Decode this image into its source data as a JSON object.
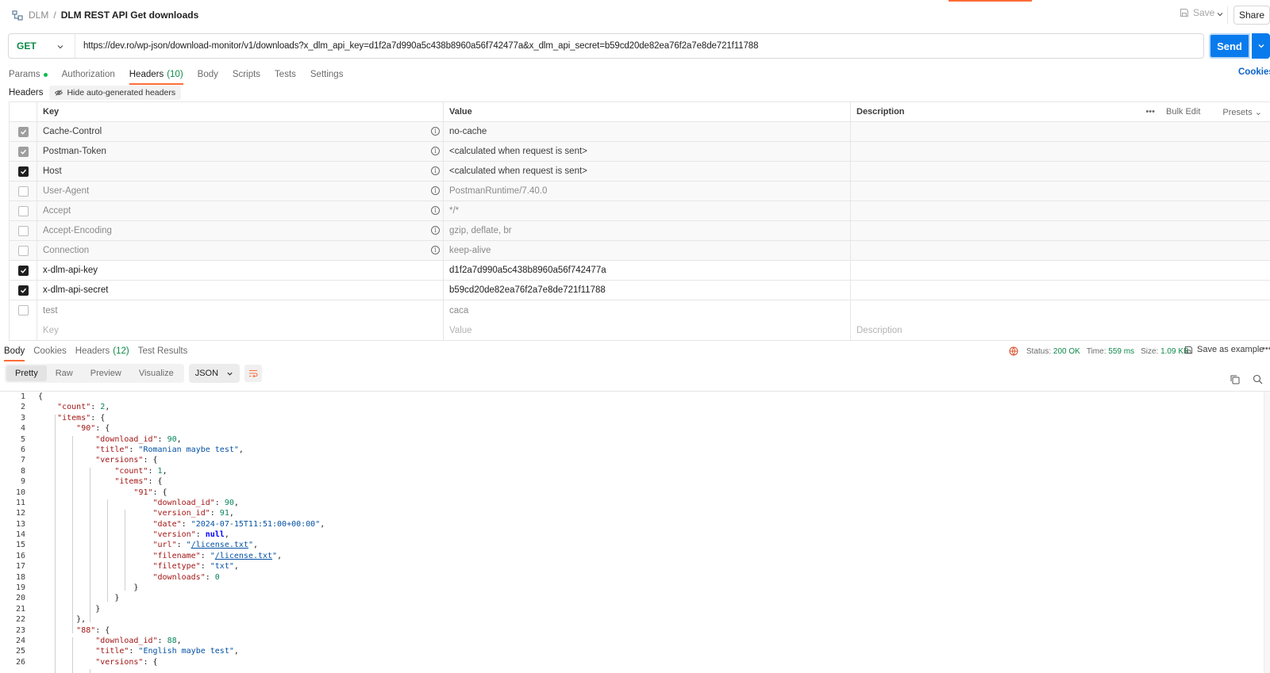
{
  "breadcrumb": {
    "collection": "DLM",
    "separator": "/",
    "request": "DLM REST API Get downloads"
  },
  "top_actions": {
    "save": "Save",
    "share": "Share"
  },
  "request": {
    "method": "GET",
    "url": "https://dev.ro/wp-json/download-monitor/v1/downloads?x_dlm_api_key=d1f2a7d990a5c438b8960a56f742477a&x_dlm_api_secret=b59cd20de82ea76f2a7e8de721f11788",
    "send": "Send"
  },
  "request_tabs": [
    {
      "label": "Params",
      "dot": true
    },
    {
      "label": "Authorization"
    },
    {
      "label": "Headers",
      "count": "(10)",
      "active": true
    },
    {
      "label": "Body"
    },
    {
      "label": "Scripts"
    },
    {
      "label": "Tests"
    },
    {
      "label": "Settings"
    }
  ],
  "cookies_link": "Cookies",
  "headers_section": {
    "label": "Headers",
    "hide_button": "Hide auto-generated headers"
  },
  "headers_table": {
    "columns": {
      "key": "Key",
      "value": "Value",
      "description": "Description"
    },
    "actions": {
      "bulk_edit": "Bulk Edit",
      "presets": "Presets"
    },
    "rows": [
      {
        "key": "Cache-Control",
        "value": "no-cache",
        "checked": "auto",
        "info": true,
        "style": "auto"
      },
      {
        "key": "Postman-Token",
        "value": "<calculated when request is sent>",
        "checked": "auto",
        "info": true,
        "style": "auto"
      },
      {
        "key": "Host",
        "value": "<calculated when request is sent>",
        "checked": "on",
        "info": true,
        "style": "auto"
      },
      {
        "key": "User-Agent",
        "value": "PostmanRuntime/7.40.0",
        "checked": "off",
        "info": true,
        "style": "autooff"
      },
      {
        "key": "Accept",
        "value": "*/*",
        "checked": "off",
        "info": true,
        "style": "autooff"
      },
      {
        "key": "Accept-Encoding",
        "value": "gzip, deflate, br",
        "checked": "off",
        "info": true,
        "style": "autooff"
      },
      {
        "key": "Connection",
        "value": "keep-alive",
        "checked": "off",
        "info": true,
        "style": "autooff"
      },
      {
        "key": "x-dlm-api-key",
        "value": "d1f2a7d990a5c438b8960a56f742477a",
        "checked": "on",
        "info": false,
        "style": "normal"
      },
      {
        "key": "x-dlm-api-secret",
        "value": "b59cd20de82ea76f2a7e8de721f11788",
        "checked": "on",
        "info": false,
        "style": "normal"
      },
      {
        "key": "test",
        "value": "caca",
        "checked": "off",
        "info": false,
        "style": "disabled"
      }
    ],
    "placeholder": {
      "key": "Key",
      "value": "Value",
      "description": "Description"
    }
  },
  "response_tabs": [
    {
      "label": "Body",
      "active": true
    },
    {
      "label": "Cookies"
    },
    {
      "label": "Headers",
      "count": "(12)"
    },
    {
      "label": "Test Results"
    }
  ],
  "response_status": {
    "status_label": "Status:",
    "status_value": "200 OK",
    "time_label": "Time:",
    "time_value": "559 ms",
    "size_label": "Size:",
    "size_value": "1.09 KB",
    "save_example": "Save as example"
  },
  "view_modes": [
    "Pretty",
    "Raw",
    "Preview",
    "Visualize"
  ],
  "active_view": "Pretty",
  "format": "JSON",
  "colors": {
    "accent": "#ff6c37",
    "primary": "#097bed",
    "ok": "#0f8a4a"
  },
  "code_lines": [
    [
      [
        "p",
        "{"
      ]
    ],
    [
      [
        "p",
        "    "
      ],
      [
        "k",
        "\"count\""
      ],
      [
        "p",
        ": "
      ],
      [
        "n",
        "2"
      ],
      [
        "p",
        ","
      ]
    ],
    [
      [
        "p",
        "    "
      ],
      [
        "k",
        "\"items\""
      ],
      [
        "p",
        ": {"
      ]
    ],
    [
      [
        "p",
        "        "
      ],
      [
        "k",
        "\"90\""
      ],
      [
        "p",
        ": {"
      ]
    ],
    [
      [
        "p",
        "            "
      ],
      [
        "k",
        "\"download_id\""
      ],
      [
        "p",
        ": "
      ],
      [
        "n",
        "90"
      ],
      [
        "p",
        ","
      ]
    ],
    [
      [
        "p",
        "            "
      ],
      [
        "k",
        "\"title\""
      ],
      [
        "p",
        ": "
      ],
      [
        "s",
        "\"Romanian maybe test\""
      ],
      [
        "p",
        ","
      ]
    ],
    [
      [
        "p",
        "            "
      ],
      [
        "k",
        "\"versions\""
      ],
      [
        "p",
        ": {"
      ]
    ],
    [
      [
        "p",
        "                "
      ],
      [
        "k",
        "\"count\""
      ],
      [
        "p",
        ": "
      ],
      [
        "n",
        "1"
      ],
      [
        "p",
        ","
      ]
    ],
    [
      [
        "p",
        "                "
      ],
      [
        "k",
        "\"items\""
      ],
      [
        "p",
        ": {"
      ]
    ],
    [
      [
        "p",
        "                    "
      ],
      [
        "k",
        "\"91\""
      ],
      [
        "p",
        ": {"
      ]
    ],
    [
      [
        "p",
        "                        "
      ],
      [
        "k",
        "\"download_id\""
      ],
      [
        "p",
        ": "
      ],
      [
        "n",
        "90"
      ],
      [
        "p",
        ","
      ]
    ],
    [
      [
        "p",
        "                        "
      ],
      [
        "k",
        "\"version_id\""
      ],
      [
        "p",
        ": "
      ],
      [
        "n",
        "91"
      ],
      [
        "p",
        ","
      ]
    ],
    [
      [
        "p",
        "                        "
      ],
      [
        "k",
        "\"date\""
      ],
      [
        "p",
        ": "
      ],
      [
        "s",
        "\"2024-07-15T11:51:00+00:00\""
      ],
      [
        "p",
        ","
      ]
    ],
    [
      [
        "p",
        "                        "
      ],
      [
        "k",
        "\"version\""
      ],
      [
        "p",
        ": "
      ],
      [
        "kw",
        "null"
      ],
      [
        "p",
        ","
      ]
    ],
    [
      [
        "p",
        "                        "
      ],
      [
        "k",
        "\"url\""
      ],
      [
        "p",
        ": "
      ],
      [
        "s",
        "\""
      ],
      [
        "l",
        "/license.txt"
      ],
      [
        "s",
        "\""
      ],
      [
        "p",
        ","
      ]
    ],
    [
      [
        "p",
        "                        "
      ],
      [
        "k",
        "\"filename\""
      ],
      [
        "p",
        ": "
      ],
      [
        "s",
        "\""
      ],
      [
        "l",
        "/license.txt"
      ],
      [
        "s",
        "\""
      ],
      [
        "p",
        ","
      ]
    ],
    [
      [
        "p",
        "                        "
      ],
      [
        "k",
        "\"filetype\""
      ],
      [
        "p",
        ": "
      ],
      [
        "s",
        "\"txt\""
      ],
      [
        "p",
        ","
      ]
    ],
    [
      [
        "p",
        "                        "
      ],
      [
        "k",
        "\"downloads\""
      ],
      [
        "p",
        ": "
      ],
      [
        "n",
        "0"
      ]
    ],
    [
      [
        "p",
        "                    }"
      ]
    ],
    [
      [
        "p",
        "                }"
      ]
    ],
    [
      [
        "p",
        "            }"
      ]
    ],
    [
      [
        "p",
        "        },"
      ]
    ],
    [
      [
        "p",
        "        "
      ],
      [
        "k",
        "\"88\""
      ],
      [
        "p",
        ": {"
      ]
    ],
    [
      [
        "p",
        "            "
      ],
      [
        "k",
        "\"download_id\""
      ],
      [
        "p",
        ": "
      ],
      [
        "n",
        "88"
      ],
      [
        "p",
        ","
      ]
    ],
    [
      [
        "p",
        "            "
      ],
      [
        "k",
        "\"title\""
      ],
      [
        "p",
        ": "
      ],
      [
        "s",
        "\"English maybe test\""
      ],
      [
        "p",
        ","
      ]
    ],
    [
      [
        "p",
        "            "
      ],
      [
        "k",
        "\"versions\""
      ],
      [
        "p",
        ": {"
      ]
    ]
  ]
}
